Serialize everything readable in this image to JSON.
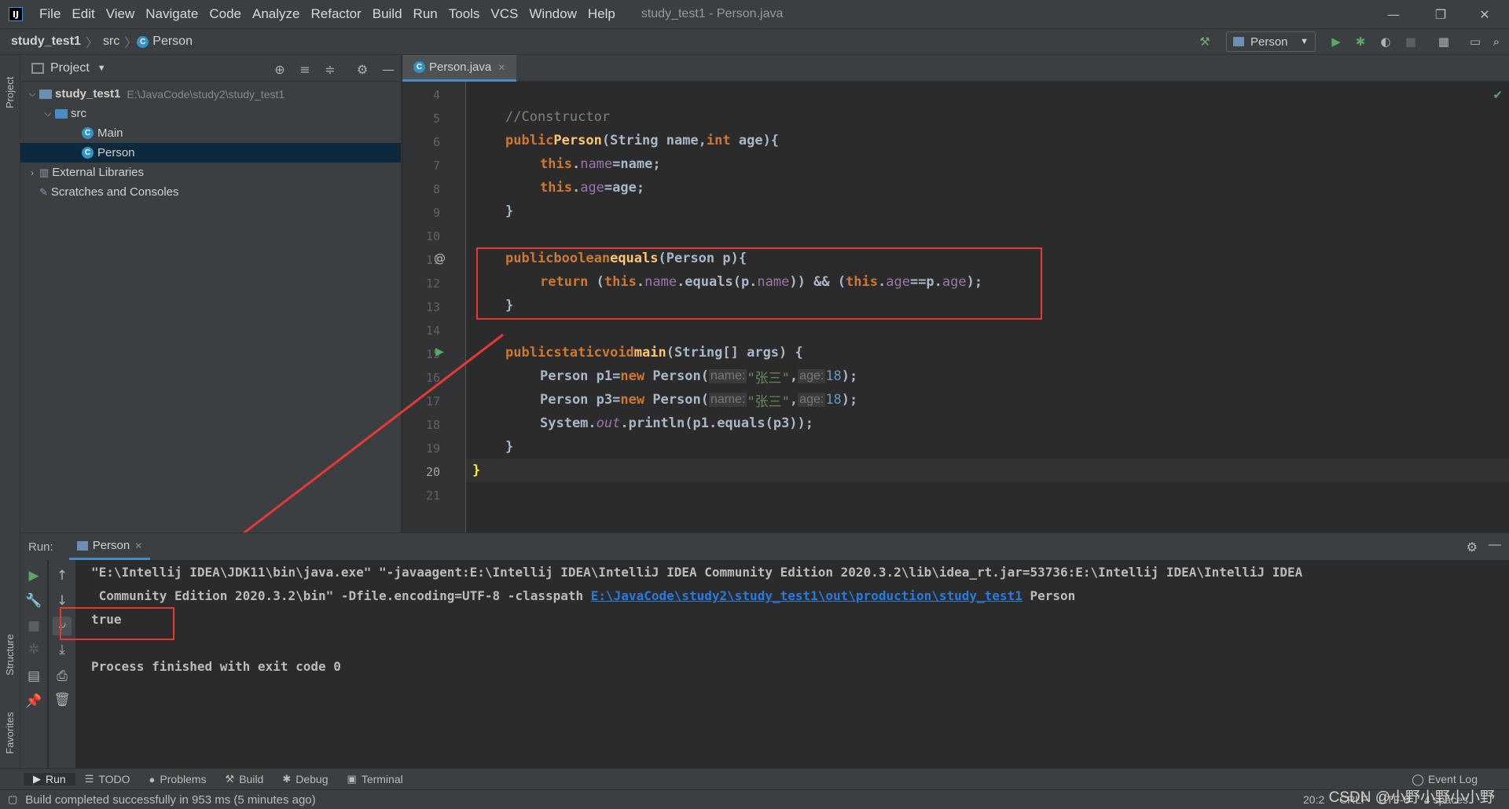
{
  "menu": {
    "items": [
      "File",
      "Edit",
      "View",
      "Navigate",
      "Code",
      "Analyze",
      "Refactor",
      "Build",
      "Run",
      "Tools",
      "VCS",
      "Window",
      "Help"
    ],
    "window_title": "study_test1 - Person.java"
  },
  "navbar": {
    "project": "study_test1",
    "folder": "src",
    "file": "Person",
    "run_config": "Person"
  },
  "project_panel": {
    "title": "Project",
    "tree": [
      {
        "label": "study_test1",
        "path": "E:\\JavaCode\\study2\\study_test1"
      },
      {
        "label": "src"
      },
      {
        "label": "Main"
      },
      {
        "label": "Person"
      },
      {
        "label": "External Libraries"
      },
      {
        "label": "Scratches and Consoles"
      }
    ]
  },
  "left_strip": {
    "project": "Project",
    "structure": "Structure",
    "favorites": "Favorites"
  },
  "editor": {
    "tab": "Person.java",
    "line_numbers": [
      "4",
      "5",
      "6",
      "7",
      "8",
      "9",
      "10",
      "11",
      "12",
      "13",
      "14",
      "15",
      "16",
      "17",
      "18",
      "19",
      "20",
      "21"
    ],
    "current_line": "20",
    "tokens": {
      "comment_ctor": "//Constructor",
      "public": "public",
      "static": "static",
      "void": "void",
      "boolean": "boolean",
      "int": "int",
      "new": "new",
      "this": "this",
      "return": "return",
      "ctor_name": "Person",
      "string_param": "(String name,",
      "age_param": " age){",
      "name_field": "name",
      "age_field": "age",
      "eq_name": "=name;",
      "eq_age": "=age;",
      "close_brace": "}",
      "equals_fn": "equals",
      "equals_sig": "(Person p){",
      "ret_open": " (",
      "dot": ".",
      "dot_equals_p": ".equals(p.",
      "ret_mid": ")) && (",
      "eqeq_p": "==p.",
      "ret_close": ");",
      "main_fn": "main",
      "main_sig": "(String[] args) {",
      "p1_decl": "Person p1=",
      "p3_decl": "Person p3=",
      "person_open": " Person(",
      "hint_name": "name:",
      "str_zhangsan": "\"张三\"",
      "comma": ",",
      "hint_age": "age:",
      "num_18": "18",
      "close_stmt": ");",
      "sysout": "System.",
      "out": "out",
      "println": ".println(p1.equals(p3));"
    }
  },
  "run_panel": {
    "label": "Run:",
    "tab": "Person",
    "console": {
      "line1": "\"E:\\Intellij IDEA\\JDK11\\bin\\java.exe\" \"-javaagent:E:\\Intellij IDEA\\IntelliJ IDEA Community Edition 2020.3.2\\lib\\idea_rt.jar=53736:E:\\Intellij IDEA\\IntelliJ IDEA",
      "line2_prefix": " Community Edition 2020.3.2\\bin\" -Dfile.encoding=UTF-8 -classpath ",
      "line2_link": "E:\\JavaCode\\study2\\study_test1\\out\\production\\study_test1",
      "line2_suffix": " Person",
      "output": "true",
      "exit": "Process finished with exit code 0"
    }
  },
  "bottom_tabs": [
    {
      "icon": "▶",
      "label": "Run"
    },
    {
      "icon": "☰",
      "label": "TODO"
    },
    {
      "icon": "●",
      "label": "Problems"
    },
    {
      "icon": "⚒",
      "label": "Build"
    },
    {
      "icon": "✱",
      "label": "Debug"
    },
    {
      "icon": "▣",
      "label": "Terminal"
    }
  ],
  "event_log": "Event Log",
  "status": {
    "message": "Build completed successfully in 953 ms (5 minutes ago)",
    "position": "20:2",
    "line_sep": "CRLF",
    "encoding": "UTF-8",
    "indent": "4 spaces"
  },
  "watermark": "CSDN @小野小野小小野",
  "colors": {
    "keyword": "#cc7832",
    "field": "#9876aa",
    "method": "#ffc66d",
    "number": "#6897bb",
    "string": "#6a8759",
    "annotation_red": "#e53935"
  }
}
